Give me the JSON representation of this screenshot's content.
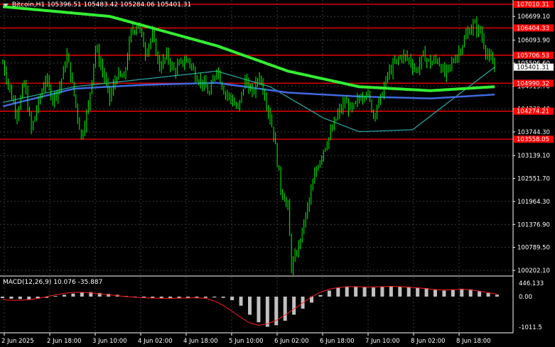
{
  "symbol_info": {
    "symbol": "Bitcoin,H1",
    "ohlc": "105396.51 105483.42 105284.06 105401.31"
  },
  "macd_info": {
    "label": "MACD(12,26,9) 10.076 -35.887"
  },
  "colors": {
    "background": "#000000",
    "candles": "#00ff00",
    "ma_slow": "#33ee33",
    "ma_blue": "#4169e1",
    "ma_teal": "#2aa0a0",
    "levels": "#ff0000",
    "grid": "#3a3a3a",
    "macd_hist": "#c0c0c0",
    "macd_signal": "#ff2020"
  },
  "chart_data": {
    "type": "candlestick",
    "title": "Bitcoin,H1",
    "ylim": [
      100202.1,
      107010.31
    ],
    "price_axis_ticks": [
      "106699.10",
      "106093.90",
      "105506.60",
      "104915.70",
      "104330.40",
      "103744.30",
      "103139.10",
      "102551.70",
      "101964.30",
      "101376.90",
      "100789.50",
      "100202.10"
    ],
    "current_price": "105401.31",
    "levels": [
      "107010.31",
      "106404.33",
      "105706.53",
      "104990.32",
      "104274.21",
      "103558.05"
    ],
    "time_labels": [
      "2 Jun 2025",
      "2 Jun 18:00",
      "3 Jun 10:00",
      "4 Jun 02:00",
      "4 Jun 18:00",
      "5 Jun 10:00",
      "6 Jun 02:00",
      "6 Jun 18:00",
      "7 Jun 10:00",
      "8 Jun 02:00",
      "8 Jun 18:00"
    ],
    "close_path": [
      [
        0,
        105500
      ],
      [
        4,
        104800
      ],
      [
        8,
        104200
      ],
      [
        12,
        105000
      ],
      [
        16,
        103800
      ],
      [
        20,
        104500
      ],
      [
        24,
        105100
      ],
      [
        28,
        104600
      ],
      [
        32,
        104900
      ],
      [
        36,
        105700
      ],
      [
        40,
        104700
      ],
      [
        44,
        103600
      ],
      [
        48,
        104400
      ],
      [
        52,
        105900
      ],
      [
        56,
        105300
      ],
      [
        60,
        104600
      ],
      [
        64,
        105200
      ],
      [
        68,
        105100
      ],
      [
        72,
        106300
      ],
      [
        76,
        106500
      ],
      [
        80,
        105800
      ],
      [
        84,
        106200
      ],
      [
        88,
        105400
      ],
      [
        92,
        105700
      ],
      [
        96,
        105300
      ],
      [
        100,
        105500
      ],
      [
        104,
        105600
      ],
      [
        108,
        105200
      ],
      [
        112,
        105000
      ],
      [
        116,
        104700
      ],
      [
        120,
        105400
      ],
      [
        124,
        104800
      ],
      [
        128,
        104600
      ],
      [
        132,
        104300
      ],
      [
        136,
        105100
      ],
      [
        140,
        104700
      ],
      [
        144,
        105200
      ],
      [
        148,
        104500
      ],
      [
        152,
        103700
      ],
      [
        156,
        102300
      ],
      [
        160,
        101800
      ],
      [
        162,
        100300
      ],
      [
        164,
        100500
      ],
      [
        168,
        101200
      ],
      [
        172,
        102000
      ],
      [
        176,
        102800
      ],
      [
        180,
        103300
      ],
      [
        184,
        103700
      ],
      [
        188,
        104200
      ],
      [
        192,
        104500
      ],
      [
        196,
        104300
      ],
      [
        200,
        104600
      ],
      [
        204,
        104800
      ],
      [
        208,
        104200
      ],
      [
        212,
        104600
      ],
      [
        216,
        105200
      ],
      [
        220,
        105500
      ],
      [
        224,
        105700
      ],
      [
        228,
        105600
      ],
      [
        232,
        105300
      ],
      [
        236,
        105700
      ],
      [
        240,
        105500
      ],
      [
        244,
        105600
      ],
      [
        248,
        105200
      ],
      [
        252,
        105500
      ],
      [
        256,
        105800
      ],
      [
        260,
        106200
      ],
      [
        264,
        106500
      ],
      [
        268,
        106300
      ],
      [
        272,
        105700
      ],
      [
        276,
        105400
      ]
    ],
    "ma_green_path": [
      [
        0,
        106950
      ],
      [
        60,
        106700
      ],
      [
        120,
        105950
      ],
      [
        160,
        105300
      ],
      [
        200,
        104900
      ],
      [
        240,
        104800
      ],
      [
        276,
        104900
      ]
    ],
    "ma_blue_path": [
      [
        0,
        104400
      ],
      [
        40,
        104850
      ],
      [
        80,
        104950
      ],
      [
        120,
        105000
      ],
      [
        160,
        104750
      ],
      [
        200,
        104650
      ],
      [
        240,
        104600
      ],
      [
        276,
        104700
      ]
    ],
    "ma_teal_path": [
      [
        0,
        104500
      ],
      [
        40,
        104900
      ],
      [
        80,
        105100
      ],
      [
        120,
        105300
      ],
      [
        150,
        104900
      ],
      [
        180,
        104100
      ],
      [
        200,
        103750
      ],
      [
        230,
        103800
      ],
      [
        250,
        104500
      ],
      [
        276,
        105400
      ]
    ],
    "macd": {
      "ylim": [
        -1011.5,
        446.133
      ],
      "axis_ticks": [
        "446.133",
        "0.00",
        "-1011.5"
      ],
      "histogram": [
        -50,
        -70,
        -80,
        -90,
        -70,
        -40,
        20,
        60,
        100,
        140,
        150,
        120,
        90,
        60,
        20,
        -10,
        -30,
        -40,
        -50,
        -60,
        -60,
        -50,
        -50,
        -40,
        -30,
        -40,
        -120,
        -300,
        -600,
        -850,
        -1000,
        -950,
        -800,
        -600,
        -400,
        -200,
        50,
        200,
        300,
        320,
        330,
        310,
        300,
        320,
        340,
        330,
        320,
        300,
        280,
        240,
        200,
        220,
        260,
        240,
        180,
        120,
        60
      ],
      "signal": [
        -100,
        -120,
        -120,
        -100,
        -60,
        0,
        60,
        110,
        140,
        140,
        120,
        90,
        60,
        30,
        0,
        -20,
        -40,
        -50,
        -55,
        -55,
        -50,
        -45,
        -40,
        -60,
        -150,
        -300,
        -500,
        -700,
        -880,
        -950,
        -900,
        -780,
        -600,
        -400,
        -200,
        0,
        150,
        250,
        300,
        330,
        330,
        320,
        320,
        330,
        340,
        330,
        310,
        290,
        260,
        230,
        220,
        230,
        240,
        220,
        180,
        130,
        80
      ]
    }
  }
}
